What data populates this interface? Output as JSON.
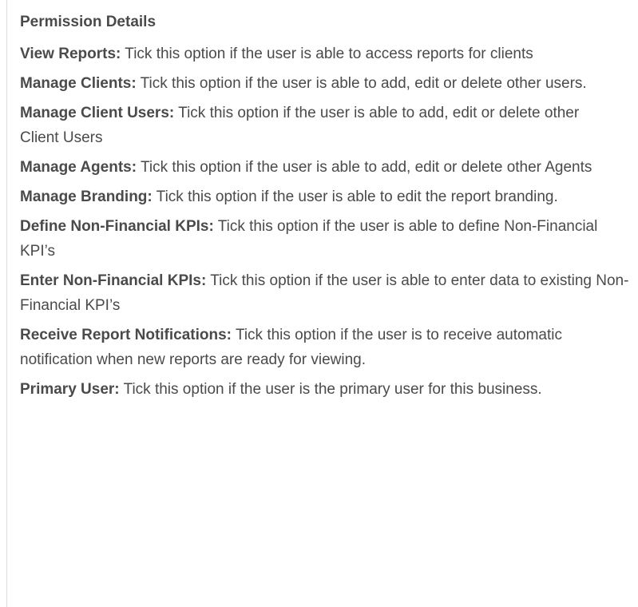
{
  "heading": "Permission Details",
  "permissions": [
    {
      "term": "View Reports:",
      "desc": "Tick this option if the user is able to access reports for clients"
    },
    {
      "term": "Manage Clients:",
      "desc": "Tick this option if the user is able to add, edit or delete other users."
    },
    {
      "term": "Manage Client Users:",
      "desc": "Tick this option if the user is able to add, edit or delete other Client Users"
    },
    {
      "term": "Manage Agents:",
      "desc": "Tick this option if the user is able to add, edit or delete other Agents"
    },
    {
      "term": "Manage Branding:",
      "desc": "Tick this option if the user is able to edit the report branding."
    },
    {
      "term": "Define Non-Financial KPIs:",
      "desc": "Tick this option if the user is able to define Non-Financial KPI’s"
    },
    {
      "term": "Enter Non-Financial KPIs:",
      "desc": "Tick this option if the user is able to enter data to existing Non-Financial KPI’s"
    },
    {
      "term": "Receive Report Notifications:",
      "desc": "Tick this option if the user is to receive automatic notification when new reports are ready for viewing."
    },
    {
      "term": "Primary User:",
      "desc": "Tick this option if the user is the primary user for this business."
    }
  ]
}
